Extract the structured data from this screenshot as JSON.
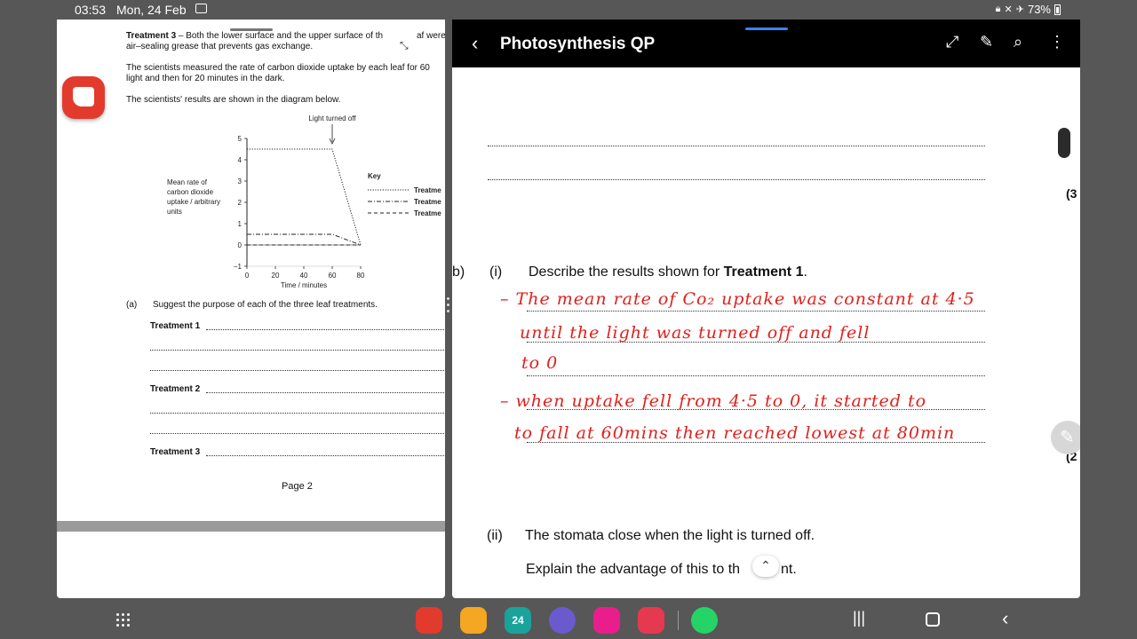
{
  "status_bar": {
    "time": "03:53",
    "date": "Mon, 24 Feb",
    "battery": "73%"
  },
  "left_doc": {
    "treatment3_para": [
      "Treatment 3",
      " – Both the lower surface and the upper surface of th",
      "af were",
      "air–sealing grease that prevents gas exchange."
    ],
    "measured_para": [
      "The scientists measured the rate of carbon dioxide uptake by each leaf for 60",
      "light and then for 20 minutes in the dark."
    ],
    "results_para": "The scientists' results are shown in the diagram below.",
    "question_a": "(a)",
    "question_a_text": "Suggest the purpose of each of the three leaf treatments.",
    "treatment_labels": [
      "Treatment 1",
      "Treatment 2",
      "Treatment 3"
    ],
    "page_label": "Page 2"
  },
  "chart_data": {
    "type": "line",
    "annotation": "Light turned off",
    "ylabel": "Mean rate of carbon dioxide uptake / arbitrary units",
    "xlabel": "Time / minutes",
    "x_ticks": [
      "0",
      "20",
      "40",
      "60",
      "80"
    ],
    "y_ticks": [
      "5",
      "4",
      "3",
      "2",
      "1",
      "0",
      "−1"
    ],
    "xlim": [
      0,
      80
    ],
    "ylim": [
      -1,
      5
    ],
    "legend_title": "Key",
    "legend": [
      "Treatme",
      "Treatme",
      "Treatme"
    ],
    "series": [
      {
        "style": "dotted",
        "x": [
          0,
          60,
          80
        ],
        "y": [
          4.5,
          4.5,
          0
        ]
      },
      {
        "style": "dash-dot",
        "x": [
          0,
          60,
          80
        ],
        "y": [
          0.5,
          0.5,
          0
        ]
      },
      {
        "style": "dashed",
        "x": [
          0,
          80
        ],
        "y": [
          0,
          0
        ]
      }
    ]
  },
  "right_doc": {
    "title": "Photosynthesis QP",
    "marks_top": "(3",
    "part_b": "b)",
    "part_i": "(i)",
    "question_i_prefix": "Describe the results shown for ",
    "question_i_bold": "Treatment 1",
    "question_i_suffix": ".",
    "handwriting": [
      "– The mean rate of Co₂ uptake was constant at 4·5",
      "until the light was turned off and fell",
      "to 0",
      "– when uptake fell from 4·5 to 0, it started to",
      "to fall at 60mins then reached lowest at 80min"
    ],
    "marks_mid": "(2",
    "part_ii": "(ii)",
    "question_ii": "The stomata close when the light is turned off.",
    "question_ii_b": "Explain the advantage of this to th",
    "question_ii_b_end": "nt."
  },
  "taskbar": {
    "apps": [
      "notes-app",
      "files-app",
      "calendar-app",
      "internet-app",
      "flower-app",
      "camera-app",
      "whatsapp-app"
    ],
    "calendar_day": "24"
  }
}
